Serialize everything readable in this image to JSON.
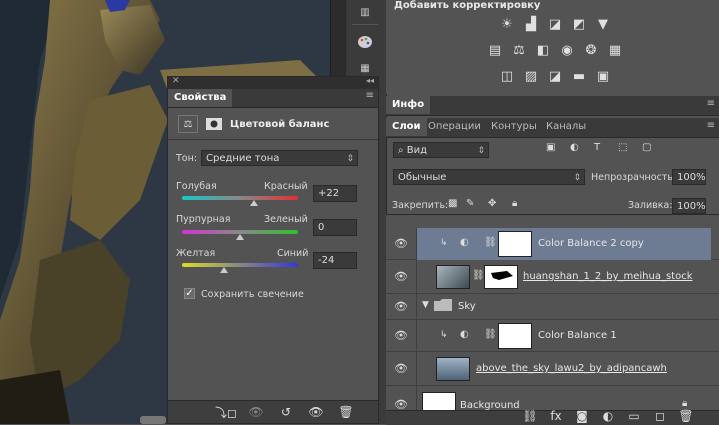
{
  "adjustments": {
    "title": "Добавить корректировку",
    "row1": [
      "brightness-icon",
      "levels-icon",
      "curves-icon",
      "exposure-icon",
      "gradient-triangle-icon"
    ],
    "row2": [
      "vibrance-icon",
      "balance-icon",
      "bw-icon",
      "photo-filter-icon",
      "channel-mixer-icon",
      "color-lookup-icon"
    ],
    "row3": [
      "invert-icon",
      "posterize-icon",
      "threshold-icon",
      "gradient-map-icon",
      "selective-color-icon"
    ]
  },
  "info_tab": "Инфо",
  "layer_tabs": [
    "Слои",
    "Операции",
    "Контуры",
    "Каналы"
  ],
  "layers_panel": {
    "filter_kind": "Вид",
    "blend_mode": "Обычные",
    "opacity_label": "Непрозрачность:",
    "opacity_value": "100%",
    "lock_label": "Закрепить:",
    "fill_label": "Заливка:",
    "fill_value": "100%"
  },
  "layers": [
    {
      "name": "Color Balance 2 copy"
    },
    {
      "name": "huangshan_1_2_by_meihua_stock"
    },
    {
      "name": "Sky"
    },
    {
      "name": "Color Balance 1"
    },
    {
      "name": "above_the_sky_lawu2_by_adipancawh"
    },
    {
      "name": "Background"
    }
  ],
  "properties": {
    "tab": "Свойства",
    "title": "Цветовой баланс",
    "tone_label": "Тон:",
    "tone_value": "Средние тона",
    "sliders": [
      {
        "left": "Голубая",
        "right": "Красный",
        "value": "+22"
      },
      {
        "left": "Пурпурная",
        "right": "Зеленый",
        "value": "0"
      },
      {
        "left": "Желтая",
        "right": "Синий",
        "value": "-24"
      }
    ],
    "slider_levels": [
      0.62,
      0.5,
      0.36
    ],
    "preserve_label": "Сохранить свечение",
    "preserve_checked": true
  }
}
